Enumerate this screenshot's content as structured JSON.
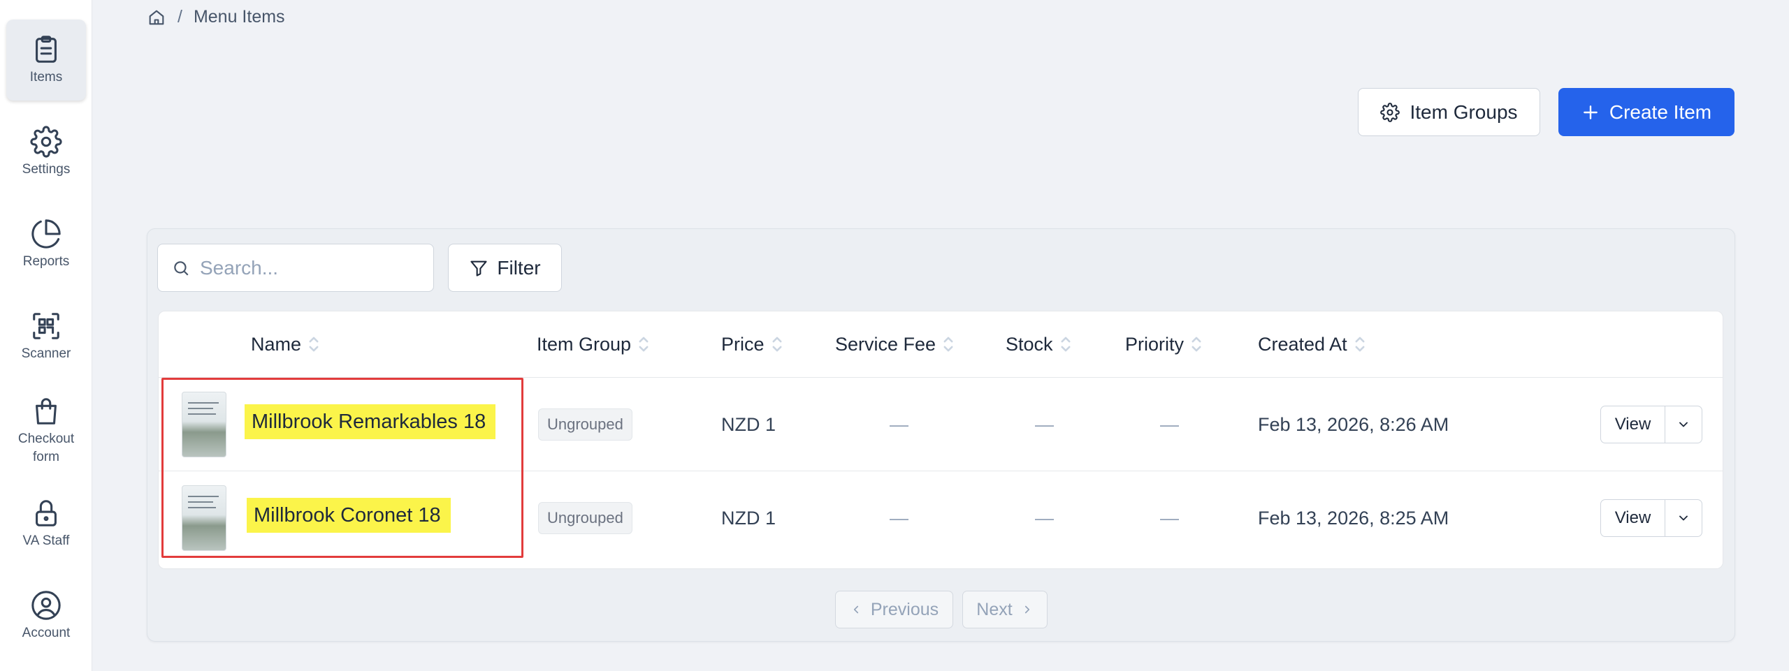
{
  "sidebar": {
    "items": [
      {
        "label": "Items",
        "icon": "clipboard-icon",
        "active": true
      },
      {
        "label": "Settings",
        "icon": "gear-icon"
      },
      {
        "label": "Reports",
        "icon": "pie-chart-icon"
      },
      {
        "label": "Scanner",
        "icon": "qr-scan-icon"
      },
      {
        "label": "Checkout form",
        "icon": "shopping-bag-icon"
      },
      {
        "label": "VA Staff",
        "icon": "lock-icon"
      },
      {
        "label": "Account",
        "icon": "user-circle-icon"
      }
    ]
  },
  "breadcrumb": {
    "separator": "/",
    "current": "Menu Items"
  },
  "header": {
    "item_groups_label": "Item Groups",
    "create_item_label": "Create Item"
  },
  "toolbar": {
    "search_placeholder": "Search...",
    "search_value": "",
    "filter_label": "Filter"
  },
  "table": {
    "columns": [
      "Name",
      "Item Group",
      "Price",
      "Service Fee",
      "Stock",
      "Priority",
      "Created At"
    ],
    "rows": [
      {
        "name": "Millbrook Remarkables 18",
        "group": "Ungrouped",
        "price": "NZD 1",
        "service_fee": "—",
        "stock": "—",
        "priority": "—",
        "created_at": "Feb 13, 2026, 8:26 AM",
        "view_label": "View"
      },
      {
        "name": "Millbrook Coronet 18",
        "group": "Ungrouped",
        "price": "NZD 1",
        "service_fee": "—",
        "stock": "—",
        "priority": "—",
        "created_at": "Feb 13, 2026, 8:25 AM",
        "view_label": "View"
      }
    ]
  },
  "pagination": {
    "previous_label": "Previous",
    "next_label": "Next"
  },
  "colors": {
    "primary": "#2563eb",
    "highlight": "#fbf44a",
    "annotation_border": "#e23c3c"
  }
}
